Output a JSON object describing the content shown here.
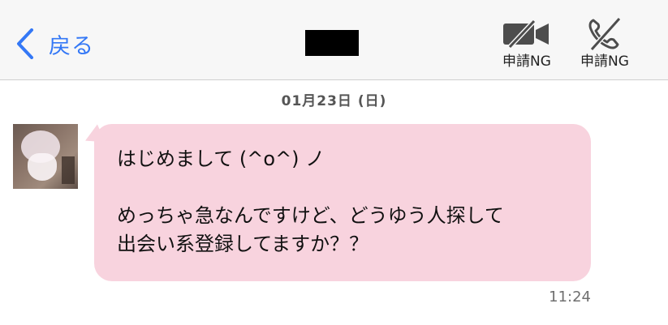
{
  "header": {
    "back_label": "戻る",
    "video_call_label": "申請NG",
    "voice_call_label": "申請NG"
  },
  "icons": {
    "back": "chevron-left-icon",
    "video_call": "video-camera-off-icon",
    "voice_call": "phone-off-icon"
  },
  "colors": {
    "accent": "#3478f6",
    "bubble": "#f8d3de",
    "header_bg": "#f7f7f7"
  },
  "chat": {
    "date": "01月23日 (日)",
    "message": {
      "lines": [
        "はじめまして (^o^) ノ",
        "",
        "めっちゃ急なんですけど、どうゆう人探して",
        "出会い系登録してますか？？"
      ],
      "time": "11:24"
    }
  }
}
